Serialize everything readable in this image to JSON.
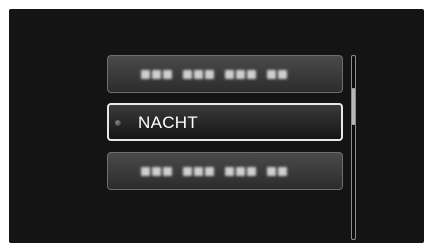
{
  "menu": {
    "items": [
      {
        "label": "",
        "state": "blurred"
      },
      {
        "label": "NACHT",
        "state": "selected"
      },
      {
        "label": "",
        "state": "blurred"
      }
    ]
  },
  "scrollbar": {
    "position_fraction": 0.22,
    "visible_fraction": 0.2
  },
  "colors": {
    "screen_background": "#141414",
    "selected_border": "#e8e8e8",
    "item_border": "#6e6e6e",
    "text": "#ffffff"
  }
}
